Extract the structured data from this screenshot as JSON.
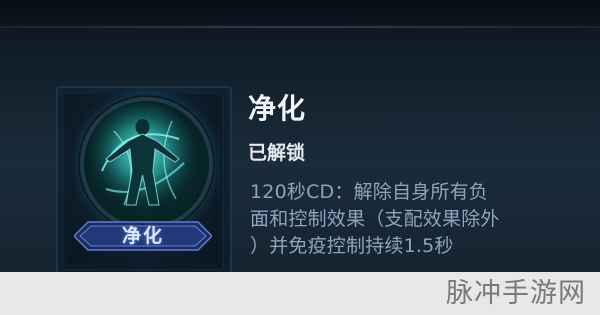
{
  "skill": {
    "name_plaque": "净化",
    "title": "净化",
    "status": "已解锁",
    "description_lines": [
      "120秒CD：解除自身所有负",
      "面和控制效果（支配效果除外",
      "）并免疫控制持续1.5秒"
    ],
    "icon": "purify-figure-icon"
  },
  "watermark": {
    "text": "脉冲手游网"
  },
  "colors": {
    "title": "#f2f4f7",
    "description": "#8fa3bd",
    "orb_glow": "#3fe0d8",
    "plaque_text": "#dbe8ff"
  }
}
